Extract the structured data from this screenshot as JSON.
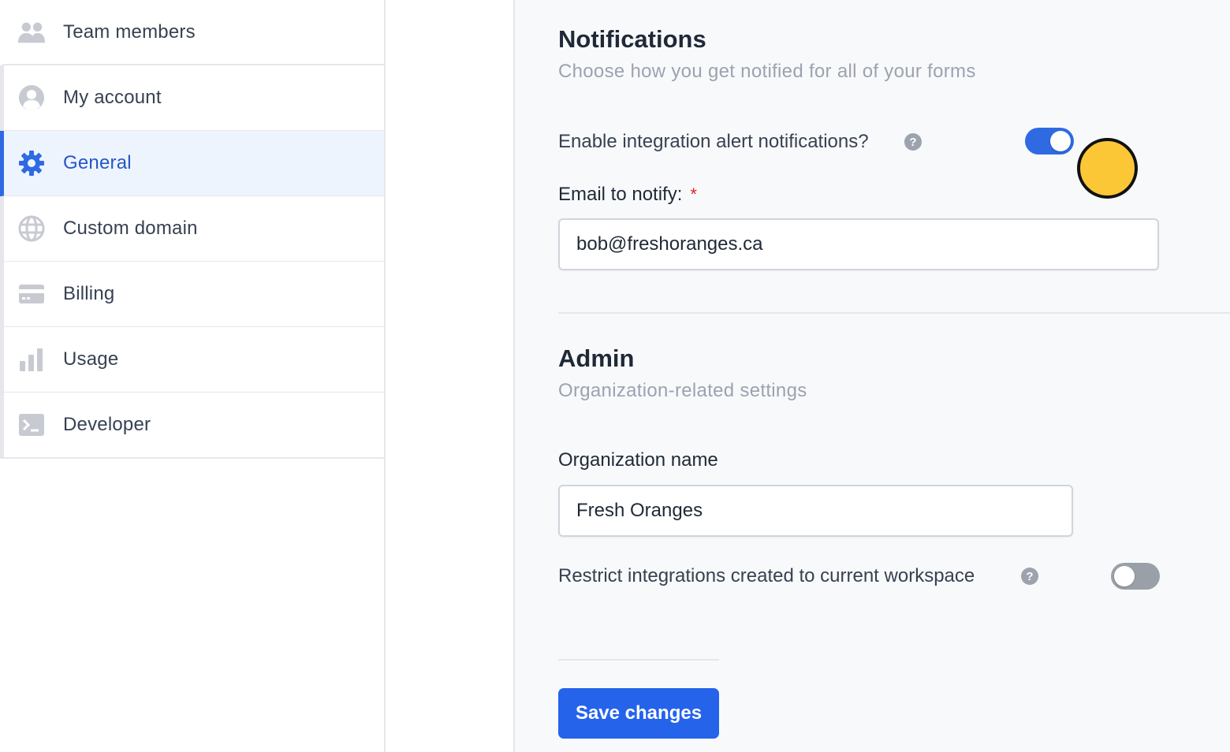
{
  "sidebar": {
    "items": [
      {
        "label": "Team members",
        "icon": "team-icon",
        "active": false
      },
      {
        "label": "My account",
        "icon": "user-circle-icon",
        "active": false
      },
      {
        "label": "General",
        "icon": "gear-icon",
        "active": true
      },
      {
        "label": "Custom domain",
        "icon": "globe-icon",
        "active": false
      },
      {
        "label": "Billing",
        "icon": "credit-card-icon",
        "active": false
      },
      {
        "label": "Usage",
        "icon": "bar-chart-icon",
        "active": false
      },
      {
        "label": "Developer",
        "icon": "terminal-icon",
        "active": false
      }
    ]
  },
  "notifications": {
    "title": "Notifications",
    "subtitle": "Choose how you get notified for all of your forms",
    "alert_label": "Enable integration alert notifications?",
    "alert_enabled": true,
    "email_label": "Email to notify:",
    "email_required": "*",
    "email_value": "bob@freshoranges.ca"
  },
  "admin": {
    "title": "Admin",
    "subtitle": "Organization-related settings",
    "org_label": "Organization name",
    "org_value": "Fresh Oranges",
    "restrict_label": "Restrict integrations created to current workspace",
    "restrict_enabled": false
  },
  "help_glyph": "?",
  "save_label": "Save changes",
  "colors": {
    "accent": "#2563eb",
    "active_bg": "#eef4fe",
    "active_text": "#2557c7",
    "cursor_marker": "#fbc737"
  }
}
